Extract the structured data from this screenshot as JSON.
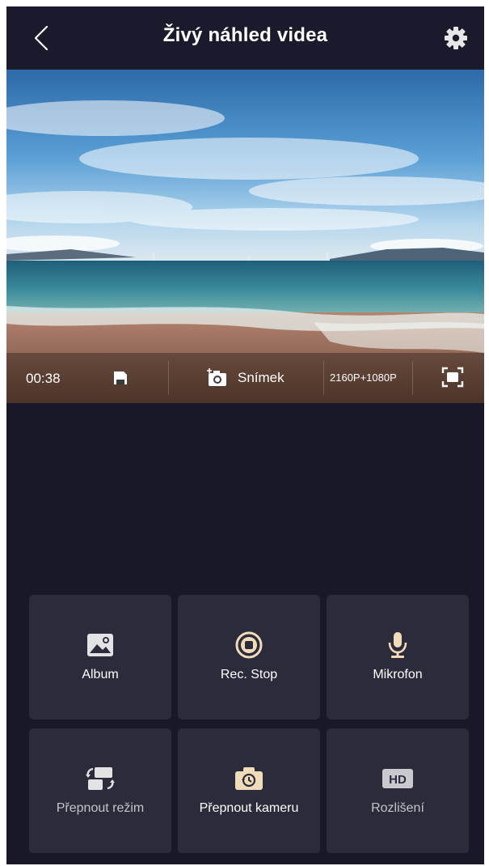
{
  "header": {
    "title": "Živý náhled videa"
  },
  "video_bar": {
    "time": "00:38",
    "snapshot_label": "Snímek",
    "resolution": "2160P+1080P"
  },
  "controls": [
    {
      "label": "Album",
      "icon": "album-icon"
    },
    {
      "label": "Rec. Stop",
      "icon": "record-stop-icon"
    },
    {
      "label": "Mikrofon",
      "icon": "microphone-icon"
    },
    {
      "label": "Přepnout režim",
      "icon": "switch-mode-icon"
    },
    {
      "label": "Přepnout kameru",
      "icon": "switch-camera-icon"
    },
    {
      "label": "Rozlišení",
      "icon": "hd-icon"
    }
  ],
  "colors": {
    "accent": "#f0dcb8",
    "background": "#181828",
    "tile": "#2b2b3b"
  }
}
